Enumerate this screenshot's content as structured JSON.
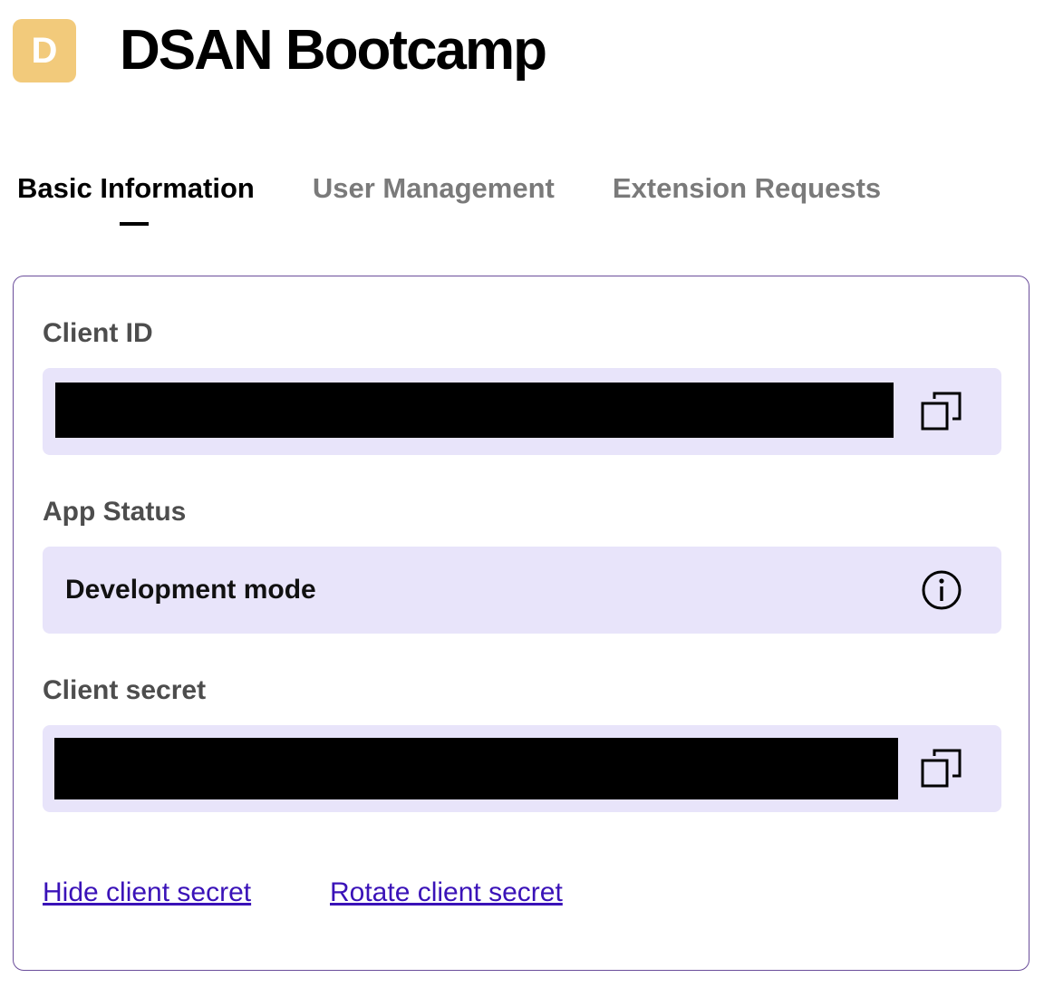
{
  "app": {
    "avatar_letter": "D",
    "title": "DSAN Bootcamp"
  },
  "tabs": [
    {
      "label": "Basic Information",
      "active": true
    },
    {
      "label": "User Management",
      "active": false
    },
    {
      "label": "Extension Requests",
      "active": false
    }
  ],
  "fields": {
    "client_id": {
      "label": "Client ID",
      "value_redacted": true,
      "icon": "copy-icon"
    },
    "app_status": {
      "label": "App Status",
      "value": "Development mode",
      "icon": "info-icon"
    },
    "client_secret": {
      "label": "Client secret",
      "value_redacted": true,
      "icon": "copy-icon"
    }
  },
  "links": {
    "hide_secret": "Hide client secret",
    "rotate_secret": "Rotate client secret"
  },
  "colors": {
    "avatar_bg": "#f2ca7b",
    "field_bg": "#e8e4fa",
    "card_border": "#6b4e9b",
    "link": "#3a12b8",
    "tab_inactive": "#7a7a7a"
  }
}
